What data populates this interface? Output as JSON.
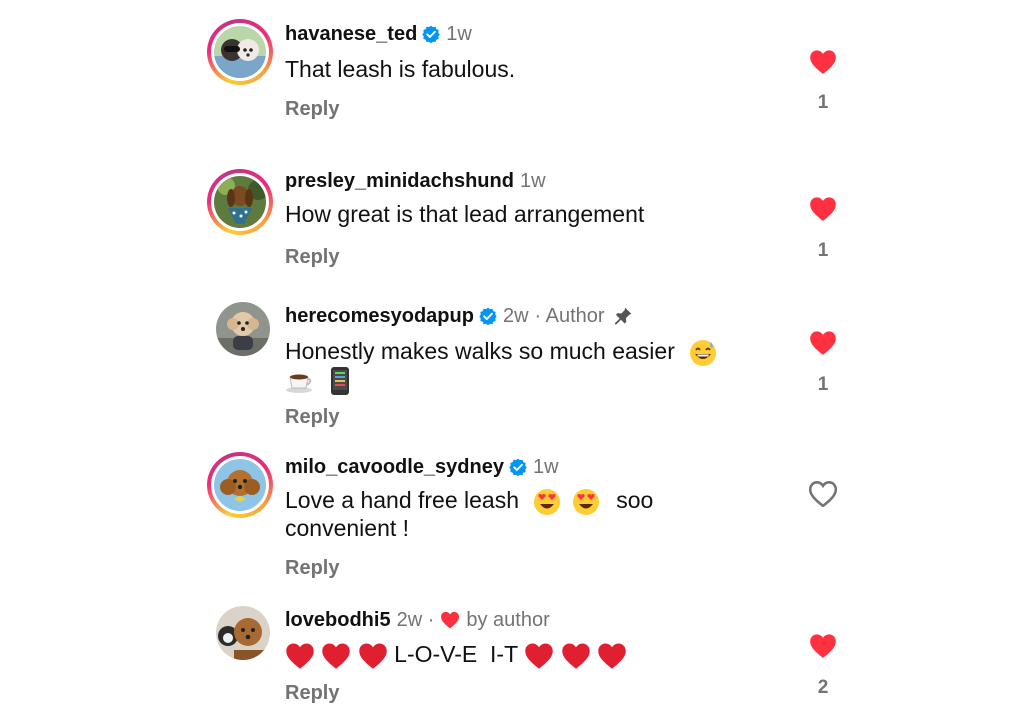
{
  "comments": [
    {
      "username": "havanese_ted",
      "time": "1w",
      "text": "That leash is fabulous.",
      "reply_label": "Reply",
      "likes": "1",
      "liked": true
    },
    {
      "username": "presley_minidachshund",
      "time": "1w",
      "text": "How great is that lead arrangement",
      "reply_label": "Reply",
      "likes": "1",
      "liked": true
    },
    {
      "username": "herecomesyodapup",
      "time": "2w",
      "author_label": "· Author",
      "text": "Honestly makes walks so much easier",
      "reply_label": "Reply",
      "likes": "1",
      "liked": true
    },
    {
      "username": "milo_cavoodle_sydney",
      "time": "1w",
      "text_line1_a": "Love a hand free leash",
      "text_line1_b": "soo",
      "text_line2": "convenient !",
      "reply_label": "Reply",
      "liked": false
    },
    {
      "username": "lovebodhi5",
      "time": "2w ·",
      "by_author": "by author",
      "text": "L-O-V-E  I-T",
      "reply_label": "Reply",
      "likes": "2",
      "liked": true
    }
  ],
  "colors": {
    "like_red": "#ff3040",
    "verified_blue": "#0095f6",
    "meta_gray": "#737373"
  }
}
